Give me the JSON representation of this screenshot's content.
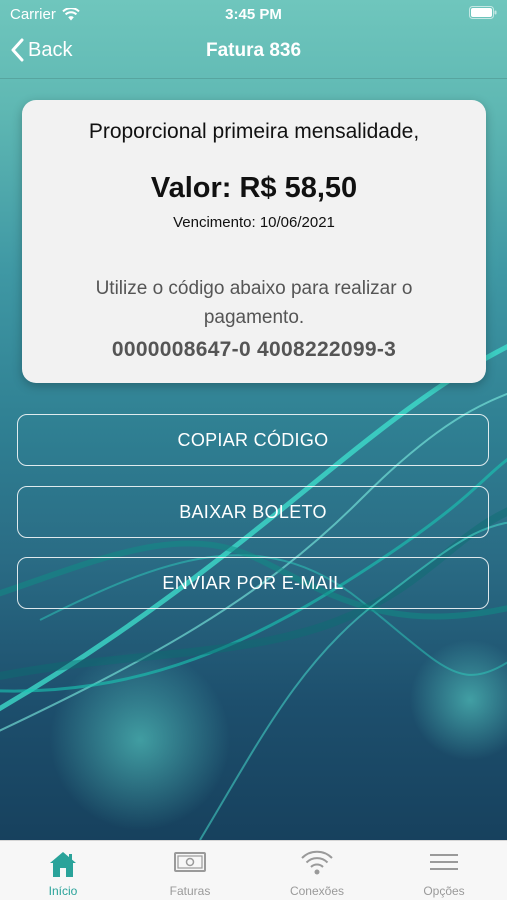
{
  "status_bar": {
    "carrier": "Carrier",
    "time": "3:45 PM"
  },
  "nav": {
    "back_label": "Back",
    "title": "Fatura 836"
  },
  "invoice": {
    "description": "Proporcional primeira mensalidade,",
    "amount": "Valor: R$ 58,50",
    "due_date": "Vencimento: 10/06/2021",
    "instruction": "Utilize o código abaixo para realizar o pagamento.",
    "code": "0000008647-0 4008222099-3"
  },
  "actions": {
    "copy": "COPIAR CÓDIGO",
    "download": "BAIXAR BOLETO",
    "email": "ENVIAR POR E-MAIL"
  },
  "tabs": [
    {
      "label": "Início",
      "icon": "home-icon",
      "active": true
    },
    {
      "label": "Faturas",
      "icon": "invoice-icon",
      "active": false
    },
    {
      "label": "Conexões",
      "icon": "wifi-icon",
      "active": false
    },
    {
      "label": "Opções",
      "icon": "menu-icon",
      "active": false
    }
  ],
  "colors": {
    "accent": "#2aa39a",
    "background_top": "#6fc6bd",
    "background_bottom": "#143b57"
  }
}
